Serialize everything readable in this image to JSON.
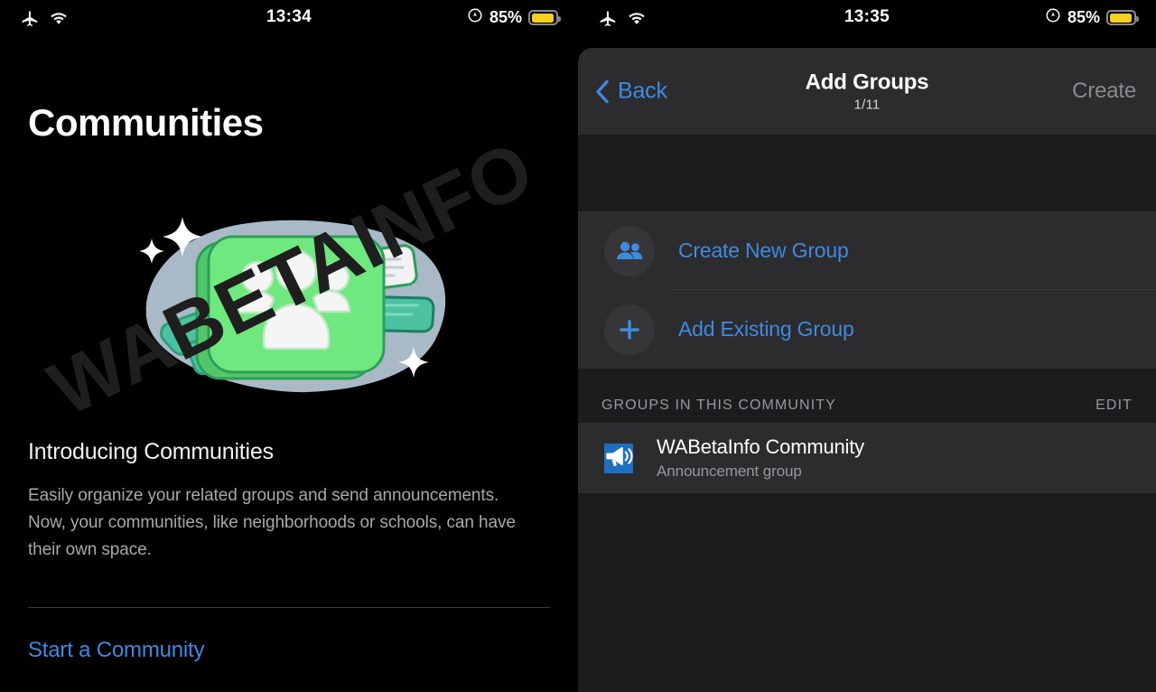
{
  "left": {
    "status_bar": {
      "airplane_icon": "airplane-icon",
      "wifi_icon": "wifi-icon",
      "time": "13:34",
      "location_icon": "location-icon",
      "battery_percent": "85%",
      "battery_icon": "battery-low-power-icon"
    },
    "page_title": "Communities",
    "illustration": {
      "name": "communities-illustration",
      "blob_color": "#aab9c6",
      "card_color": "#6ee87f",
      "card_stroke": "#2e9e5b",
      "megaphone_color": "#4cc2a0",
      "bubble_white": "#f2f2f2",
      "bubble_teal": "#4cc2a0",
      "people_color": "#f5f5f5"
    },
    "intro_heading": "Introducing Communities",
    "intro_body": "Easily organize your related groups and send announcements. Now, your communities, like neighborhoods or schools, can have their own space.",
    "start_link": "Start a Community",
    "watermark": "WABETAINFO"
  },
  "right": {
    "status_bar": {
      "airplane_icon": "airplane-icon",
      "wifi_icon": "wifi-icon",
      "time": "13:35",
      "location_icon": "location-icon",
      "battery_percent": "85%",
      "battery_icon": "battery-low-power-icon"
    },
    "navbar": {
      "back_label": "Back",
      "title": "Add Groups",
      "subtitle": "1/11",
      "create_label": "Create",
      "create_enabled": false,
      "back_color": "#3f8ae0",
      "create_color": "#8a8a8e"
    },
    "actions": [
      {
        "icon": "two-people-icon",
        "label": "Create New Group"
      },
      {
        "icon": "plus-icon",
        "label": "Add Existing Group"
      }
    ],
    "section": {
      "header": "GROUPS IN THIS COMMUNITY",
      "edit_label": "EDIT"
    },
    "groups": [
      {
        "icon": "megaphone-icon",
        "icon_bg": "#1f6fc0",
        "title": "WABetaInfo Community",
        "subtitle": "Announcement group"
      }
    ]
  }
}
